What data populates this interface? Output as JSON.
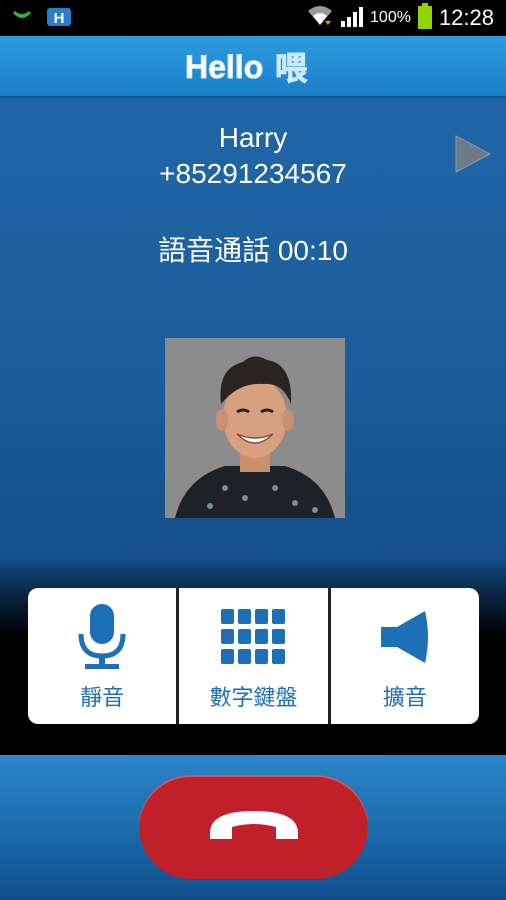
{
  "status_bar": {
    "battery": "100%",
    "time": "12:28"
  },
  "app": {
    "logo_text": "Hello",
    "logo_char": "喂"
  },
  "call": {
    "contact_name": "Harry",
    "phone_number": "+85291234567",
    "status_text": "語音通話 00:10"
  },
  "controls": {
    "mute_label": "靜音",
    "keypad_label": "數字鍵盤",
    "speaker_label": "擴音"
  },
  "icons": {
    "statusbar_left": [
      "call-notification-icon",
      "app-notification-icon"
    ],
    "statusbar_right": [
      "wifi-icon",
      "signal-icon",
      "battery-icon"
    ],
    "play": "play-icon",
    "mute": "microphone-icon",
    "keypad": "keypad-icon",
    "speaker": "speaker-icon",
    "hangup": "end-call-icon"
  },
  "colors": {
    "accent": "#1d6fb8",
    "hangup": "#c0202a",
    "battery": "#8fd400"
  }
}
